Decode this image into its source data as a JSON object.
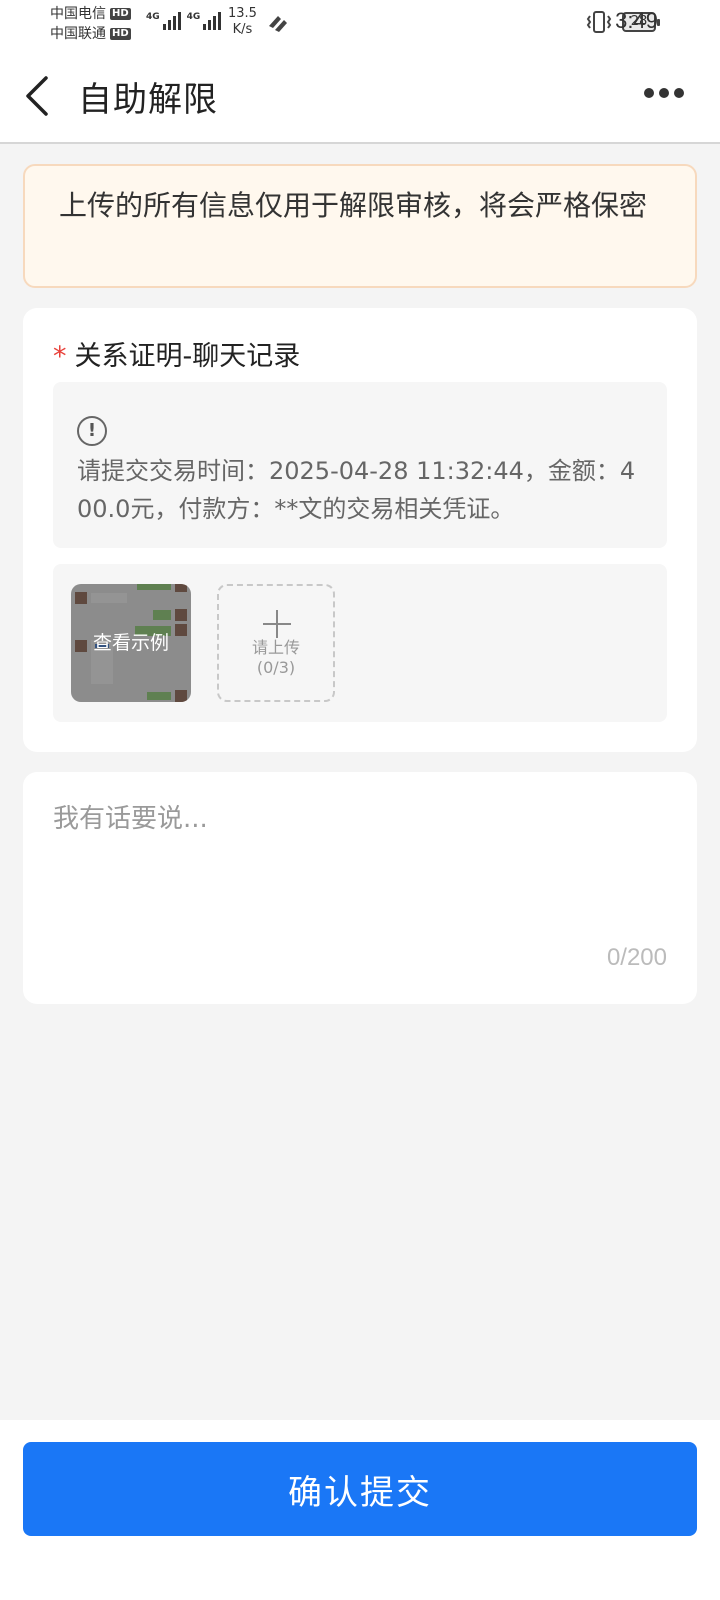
{
  "status_bar": {
    "carrier_1": "中国电信",
    "carrier_2": "中国联通",
    "hd_badge": "HD",
    "network_1": "4G",
    "network_2": "4G",
    "speed_value": "13.5",
    "speed_unit": "K/s",
    "battery": "28",
    "time": "3:49",
    "icons": [
      "signal-icon",
      "vibrate-icon",
      "battery-icon",
      "hotspot-icon"
    ]
  },
  "nav": {
    "title": "自助解限",
    "back_icon": "chevron-left-icon",
    "more_icon": "more-dots-icon"
  },
  "notice": {
    "text": "上传的所有信息仅用于解限审核，将会严格保密"
  },
  "section": {
    "required_mark": "*",
    "title": "关系证明-聊天记录",
    "hint_icon": "info-circle-icon",
    "hint_text": "请提交交易时间：2025-04-28 11:32:44，金额：400.0元，付款方：**文的交易相关凭证。",
    "example_label": "查看示例",
    "upload_label": "请上传",
    "upload_count": "(0/3)"
  },
  "comment": {
    "placeholder": "我有话要说...",
    "counter": "0/200"
  },
  "footer": {
    "submit_label": "确认提交"
  },
  "colors": {
    "primary": "#1a77f6",
    "required": "#e8413a",
    "notice_bg": "#fff8ee",
    "notice_border": "#f7d9bd"
  }
}
